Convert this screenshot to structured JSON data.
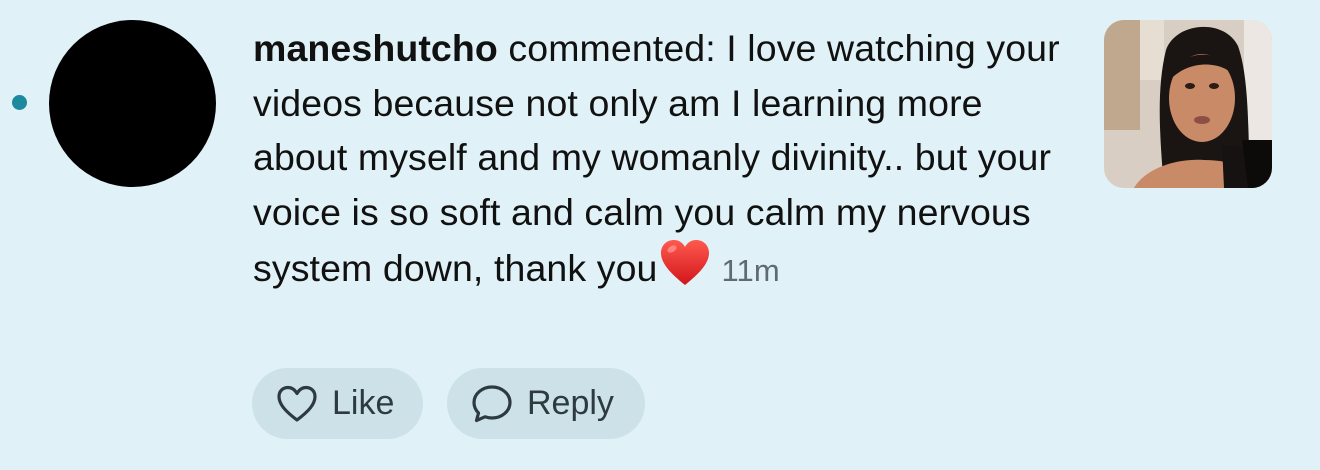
{
  "notification": {
    "username": "maneshutcho",
    "comment_text": " commented: I love watching your videos because not only am I learning more about myself and my womanly divinity.. but your voice is so soft and calm you calm my nervous system down, thank you",
    "emoji": "red-heart-emoji",
    "timestamp": "11m",
    "unread": true
  },
  "actions": {
    "like_label": "Like",
    "reply_label": "Reply"
  },
  "colors": {
    "background": "#e0f2f7",
    "unread_dot": "#1b8a9e",
    "button_bg": "#cde1e8",
    "heart": "#e11d1d"
  }
}
